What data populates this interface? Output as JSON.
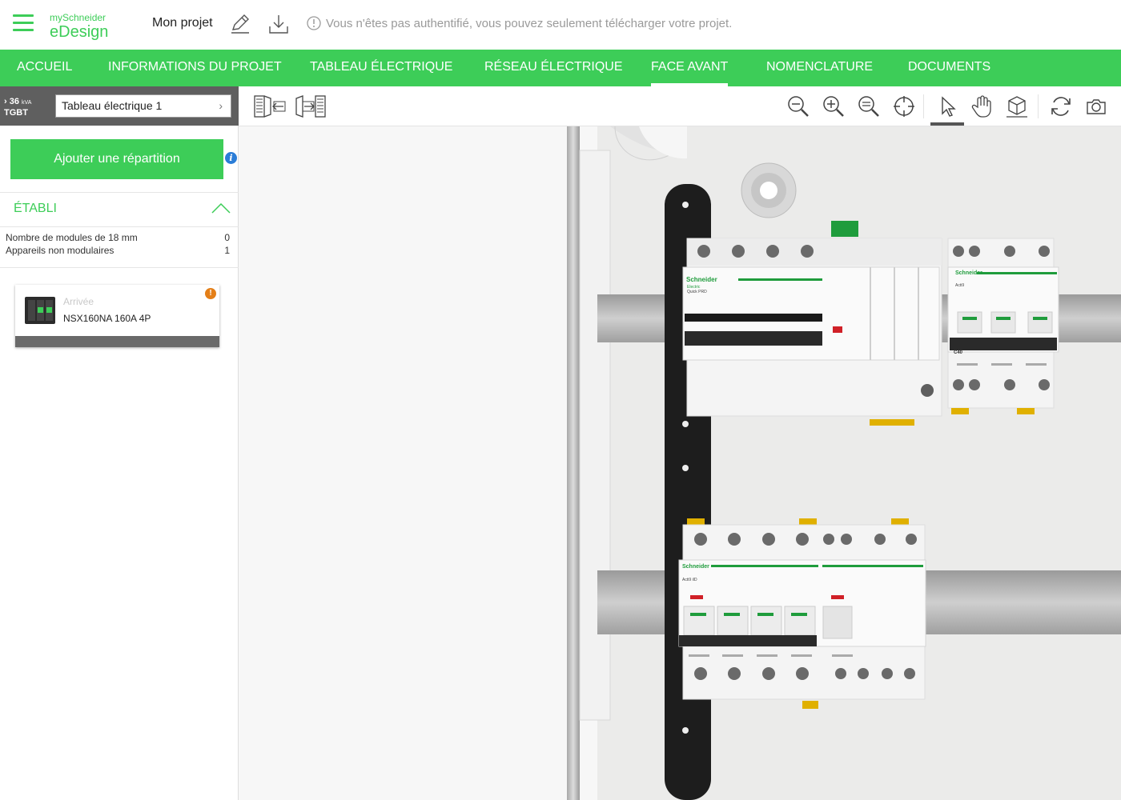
{
  "header": {
    "brand_small": "mySchneider",
    "brand_big": "eDesign",
    "project_name": "Mon projet",
    "warning": "Vous n'êtes pas authentifié, vous pouvez seulement télécharger votre projet."
  },
  "nav": {
    "items": [
      {
        "label": "ACCUEIL"
      },
      {
        "label": "INFORMATIONS DU PROJET"
      },
      {
        "label": "TABLEAU ÉLECTRIQUE"
      },
      {
        "label": "RÉSEAU ÉLECTRIQUE"
      },
      {
        "label": "FACE AVANT"
      },
      {
        "label": "NOMENCLATURE"
      },
      {
        "label": "DOCUMENTS"
      }
    ],
    "active": "FACE AVANT"
  },
  "sidebar": {
    "power_value": "36",
    "power_unit": "kVA",
    "board_code": "TGBT",
    "board_name": "Tableau électrique 1",
    "add_button": "Ajouter une répartition",
    "section_title": "ÉTABLI",
    "stats": [
      {
        "label": "Nombre de modules de 18 mm",
        "value": "0"
      },
      {
        "label": "Appareils non modulaires",
        "value": "1"
      }
    ],
    "device": {
      "label": "Arrivée",
      "name": "NSX160NA 160A 4P"
    }
  },
  "toolbar": {
    "left_icons": [
      "panel-door-in-icon",
      "panel-door-out-icon"
    ],
    "right_icons": [
      "zoom-out-icon",
      "zoom-in-icon",
      "zoom-reset-icon",
      "target-icon",
      "select-cursor-icon",
      "pan-hand-icon",
      "rotate-3d-icon",
      "refresh-icon",
      "camera-icon"
    ],
    "active_tool": "select-cursor-icon"
  },
  "viewport": {
    "breaker_brand": "Schneider",
    "breaker_sub": "Electric",
    "breaker_tags": [
      "Quick PRD",
      "Acti9",
      "C40",
      "Acti9 iID"
    ],
    "rating_small": "C40"
  },
  "colors": {
    "brand_green": "#3dcd58",
    "warning_orange": "#e47f18",
    "info_blue": "#2b7dd7",
    "dark_bar": "#5f5f5f"
  }
}
